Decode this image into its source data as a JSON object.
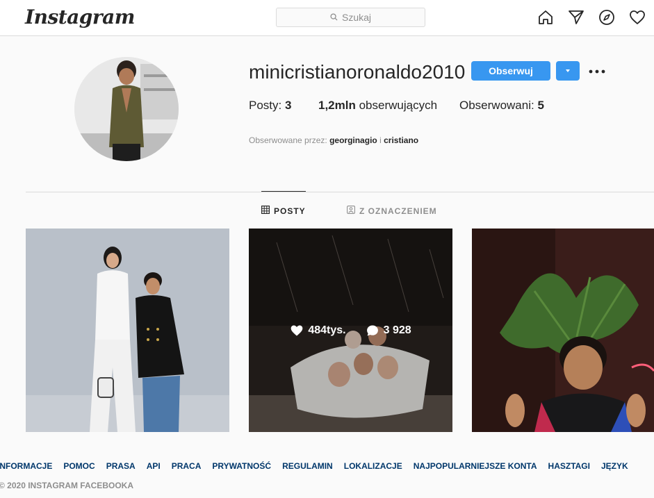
{
  "header": {
    "logo": "Instagram",
    "search_placeholder": "Szukaj",
    "icons": [
      "home-icon",
      "direct-icon",
      "explore-icon",
      "activity-icon"
    ]
  },
  "profile": {
    "username": "minicristianoronaldo2010",
    "follow_label": "Obserwuj",
    "posts_label": "Posty:",
    "posts_count": "3",
    "followers_count": "1,2mln",
    "followers_label": "obserwujących",
    "following_label": "Obserwowani:",
    "following_count": "5",
    "followed_by_label": "Obserwowane przez:",
    "followed_by_1": "georginagio",
    "followed_by_sep": "i",
    "followed_by_2": "cristiano"
  },
  "tabs": [
    {
      "label": "POSTY",
      "icon": "grid-icon",
      "active": true
    },
    {
      "label": "Z OZNACZENIEM",
      "icon": "tagged-icon",
      "active": false
    }
  ],
  "posts": [
    {
      "id": "post-1"
    },
    {
      "id": "post-2",
      "likes": "484tys.",
      "comments": "3 928",
      "hovered": true
    },
    {
      "id": "post-3"
    }
  ],
  "footer": {
    "links": [
      "INFORMACJE",
      "POMOC",
      "PRASA",
      "API",
      "PRACA",
      "PRYWATNOŚĆ",
      "REGULAMIN",
      "LOKALIZACJE",
      "NAJPOPULARNIEJSZE KONTA",
      "HASZTAGI",
      "JĘZYK"
    ],
    "copyright": "© 2020 INSTAGRAM FACEBOOKA"
  },
  "colors": {
    "accent": "#3897f0",
    "link": "#00376b",
    "muted": "#8e8e8e",
    "text": "#262626"
  }
}
